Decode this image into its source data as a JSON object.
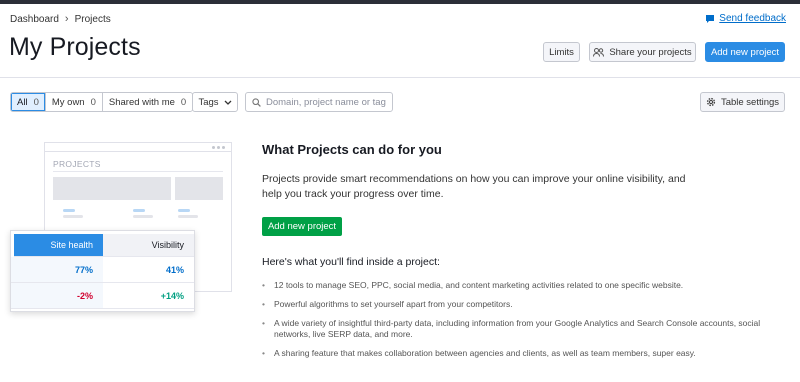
{
  "breadcrumb": {
    "root": "Dashboard",
    "current": "Projects"
  },
  "feedback_label": "Send feedback",
  "page_title": "My Projects",
  "header_buttons": {
    "limits": "Limits",
    "share": "Share your projects",
    "add": "Add new project"
  },
  "filters": [
    {
      "label": "All",
      "count": "0",
      "active": true
    },
    {
      "label": "My own",
      "count": "0",
      "active": false
    },
    {
      "label": "Shared with me",
      "count": "0",
      "active": false
    }
  ],
  "tags_label": "Tags",
  "search": {
    "placeholder": "Domain, project name or tag",
    "value": ""
  },
  "table_settings_label": "Table settings",
  "illustration": {
    "card_title": "PROJECTS",
    "table": {
      "headers": [
        "Site health",
        "Visibility"
      ],
      "rows": [
        [
          "77%",
          "41%"
        ],
        [
          "-2%",
          "+14%"
        ]
      ]
    }
  },
  "content": {
    "heading": "What Projects can do for you",
    "intro": "Projects provide smart recommendations on how you can improve your online visibility, and help you track your progress over time.",
    "cta": "Add new project",
    "subheading": "Here's what you'll find inside a project:",
    "bullets": [
      "12 tools to manage SEO, PPC, social media, and content marketing activities related to one specific website.",
      "Powerful algorithms to set yourself apart from your competitors.",
      "A wide variety of insightful third-party data, including information from your Google Analytics and Search Console accounts, social networks, live SERP data, and more.",
      "A sharing feature that makes collaboration between agencies and clients, as well as team members, super easy."
    ]
  },
  "colors": {
    "primary": "#2b8ce4",
    "success": "#00a046",
    "link": "#006dca",
    "negative": "#d1002f",
    "positive": "#009f81"
  }
}
